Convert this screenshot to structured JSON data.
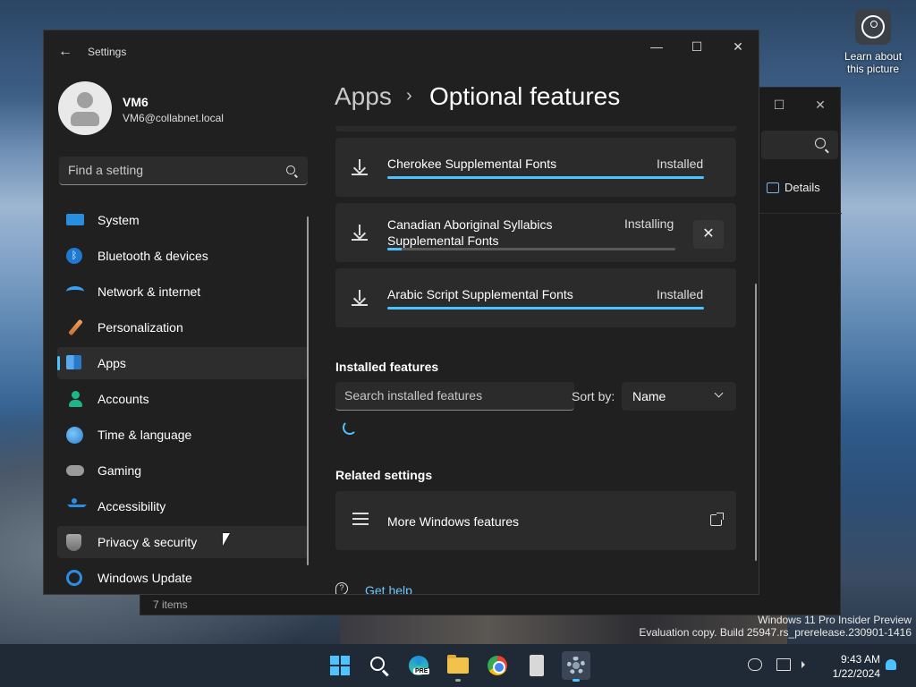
{
  "desktop": {
    "learn_label": "Learn about this picture",
    "watermark_line1": "Windows 11 Pro Insider Preview",
    "watermark_line2": "Evaluation copy. Build 25947.rs_prerelease.230901-1416"
  },
  "explorer": {
    "details_label": "Details",
    "status_count": "7 items",
    "close_glyph": "✕",
    "maximize_glyph": "☐"
  },
  "settings": {
    "app_title": "Settings",
    "back_glyph": "←",
    "minimize_glyph": "—",
    "maximize_glyph": "☐",
    "close_glyph": "✕",
    "profile": {
      "name": "VM6",
      "email": "VM6@collabnet.local"
    },
    "search_placeholder": "Find a setting",
    "nav": [
      {
        "label": "System",
        "icon": "system-icon"
      },
      {
        "label": "Bluetooth & devices",
        "icon": "bluetooth-icon"
      },
      {
        "label": "Network & internet",
        "icon": "wifi-icon"
      },
      {
        "label": "Personalization",
        "icon": "brush-icon"
      },
      {
        "label": "Apps",
        "icon": "apps-icon",
        "selected": true
      },
      {
        "label": "Accounts",
        "icon": "person-icon"
      },
      {
        "label": "Time & language",
        "icon": "globe-clock-icon"
      },
      {
        "label": "Gaming",
        "icon": "controller-icon"
      },
      {
        "label": "Accessibility",
        "icon": "accessibility-icon"
      },
      {
        "label": "Privacy & security",
        "icon": "shield-icon",
        "hover": true
      },
      {
        "label": "Windows Update",
        "icon": "update-icon"
      }
    ],
    "breadcrumb": {
      "parent": "Apps",
      "separator": "›",
      "current": "Optional features"
    },
    "downloads": [
      {
        "name": "Cherokee Supplemental Fonts",
        "status": "Installed",
        "progress": 1.0
      },
      {
        "name": "Canadian Aboriginal Syllabics Supplemental Fonts",
        "status": "Installing",
        "progress": 0.05
      },
      {
        "name": "Arabic Script Supplemental Fonts",
        "status": "Installed",
        "progress": 1.0
      }
    ],
    "cancel_glyph": "✕",
    "installed_features": {
      "title": "Installed features",
      "search_placeholder": "Search installed features",
      "sort_label": "Sort by:",
      "sort_value": "Name"
    },
    "related_settings": {
      "title": "Related settings",
      "more_features": "More Windows features"
    },
    "get_help": "Get help"
  },
  "taskbar": {
    "clock_time": "9:43 AM",
    "clock_date": "1/22/2024",
    "edge_badge": "PRE"
  },
  "colors": {
    "accent": "#4cc2ff",
    "window_bg": "#202020",
    "card_bg": "#2b2b2b"
  }
}
